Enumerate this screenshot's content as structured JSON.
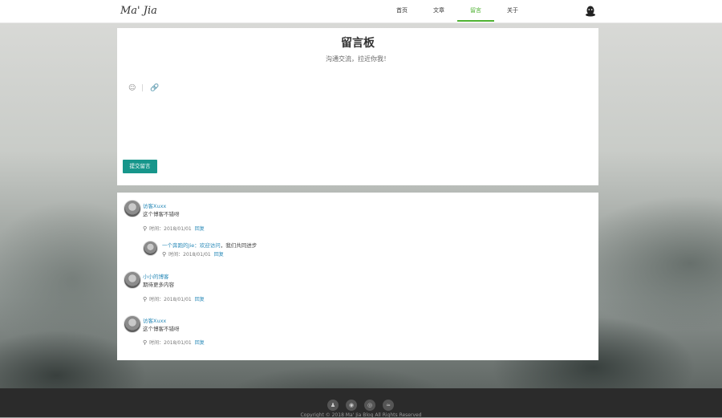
{
  "header": {
    "logo": "Ma' Jia",
    "nav": [
      {
        "label": "首页"
      },
      {
        "label": "文章"
      },
      {
        "label": "留言"
      },
      {
        "label": "关于"
      }
    ]
  },
  "board": {
    "title": "留言板",
    "subtitle": "沟通交流，拉近你我！",
    "submit_label": "提交留言"
  },
  "comments": [
    {
      "name": "访客Xuxx",
      "text": "这个博客不错呀",
      "time": "时间：2018/01/01",
      "reply_label": "回复",
      "replies": [
        {
          "name": "一个奔跑的Jie：欢迎访问",
          "text": "，我们共同进步",
          "time": "时间：2018/01/01",
          "reply_label": "回复"
        }
      ]
    },
    {
      "name": "小小的博客",
      "text": "期待更多内容",
      "time": "时间：2018/01/01",
      "reply_label": "回复",
      "replies": []
    },
    {
      "name": "访客Xuxx",
      "text": "这个博客不错呀",
      "time": "时间：2018/01/01",
      "reply_label": "回复",
      "replies": []
    }
  ],
  "footer": {
    "icons": [
      "qq-icon",
      "wechat-icon",
      "weibo-icon",
      "rss-icon"
    ],
    "copyright": "Copyright © 2018 Ma' Jia Blog All Rights Reserved"
  },
  "colors": {
    "accent": "#4fb233",
    "button": "#17968b",
    "link": "#2a8ab8"
  }
}
